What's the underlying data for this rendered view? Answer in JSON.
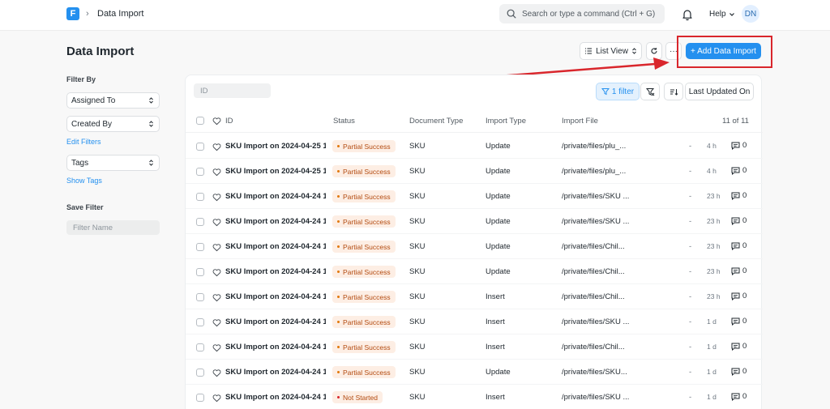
{
  "navbar": {
    "logo": "F",
    "breadcrumb": "Data Import",
    "search_placeholder": "Search or type a command (Ctrl + G)",
    "help": "Help",
    "avatar": "DN"
  },
  "header": {
    "title": "Data Import",
    "list_view": "List View",
    "more": "···",
    "add_button": "+ Add Data Import"
  },
  "sidebar": {
    "filter_by": "Filter By",
    "assigned_to": "Assigned To",
    "created_by": "Created By",
    "edit_filters": "Edit Filters",
    "tags": "Tags",
    "show_tags": "Show Tags",
    "save_filter": "Save Filter",
    "filter_name_placeholder": "Filter Name"
  },
  "list": {
    "id_placeholder": "ID",
    "filter_label": "1 filter",
    "sort_label": "Last Updated On",
    "columns": {
      "id": "ID",
      "status": "Status",
      "document_type": "Document Type",
      "import_type": "Import Type",
      "import_file": "Import File",
      "count": "11 of 11"
    },
    "rows": [
      {
        "id": "SKU Import on 2024-04-25 1",
        "status": "Partial Success",
        "doctype": "SKU",
        "import_type": "Update",
        "file": "/private/files/plu_...",
        "dash": "-",
        "time": "4 h",
        "comments": "0"
      },
      {
        "id": "SKU Import on 2024-04-25 1",
        "status": "Partial Success",
        "doctype": "SKU",
        "import_type": "Update",
        "file": "/private/files/plu_...",
        "dash": "-",
        "time": "4 h",
        "comments": "0"
      },
      {
        "id": "SKU Import on 2024-04-24 1",
        "status": "Partial Success",
        "doctype": "SKU",
        "import_type": "Update",
        "file": "/private/files/SKU ...",
        "dash": "-",
        "time": "23 h",
        "comments": "0"
      },
      {
        "id": "SKU Import on 2024-04-24 1",
        "status": "Partial Success",
        "doctype": "SKU",
        "import_type": "Update",
        "file": "/private/files/SKU ...",
        "dash": "-",
        "time": "23 h",
        "comments": "0"
      },
      {
        "id": "SKU Import on 2024-04-24 1",
        "status": "Partial Success",
        "doctype": "SKU",
        "import_type": "Update",
        "file": "/private/files/Chil...",
        "dash": "-",
        "time": "23 h",
        "comments": "0"
      },
      {
        "id": "SKU Import on 2024-04-24 1",
        "status": "Partial Success",
        "doctype": "SKU",
        "import_type": "Update",
        "file": "/private/files/Chil...",
        "dash": "-",
        "time": "23 h",
        "comments": "0"
      },
      {
        "id": "SKU Import on 2024-04-24 1",
        "status": "Partial Success",
        "doctype": "SKU",
        "import_type": "Insert",
        "file": "/private/files/Chil...",
        "dash": "-",
        "time": "23 h",
        "comments": "0"
      },
      {
        "id": "SKU Import on 2024-04-24 1",
        "status": "Partial Success",
        "doctype": "SKU",
        "import_type": "Insert",
        "file": "/private/files/SKU ...",
        "dash": "-",
        "time": "1 d",
        "comments": "0"
      },
      {
        "id": "SKU Import on 2024-04-24 1",
        "status": "Partial Success",
        "doctype": "SKU",
        "import_type": "Insert",
        "file": "/private/files/Chil...",
        "dash": "-",
        "time": "1 d",
        "comments": "0"
      },
      {
        "id": "SKU Import on 2024-04-24 1",
        "status": "Partial Success",
        "doctype": "SKU",
        "import_type": "Update",
        "file": "/private/files/SKU...",
        "dash": "-",
        "time": "1 d",
        "comments": "0"
      },
      {
        "id": "SKU Import on 2024-04-24 1",
        "status": "Not Started",
        "doctype": "SKU",
        "import_type": "Insert",
        "file": "/private/files/SKU ...",
        "dash": "-",
        "time": "1 d",
        "comments": "0"
      }
    ]
  },
  "colors": {
    "primary": "#2490ef",
    "annotation": "#d9262c"
  }
}
